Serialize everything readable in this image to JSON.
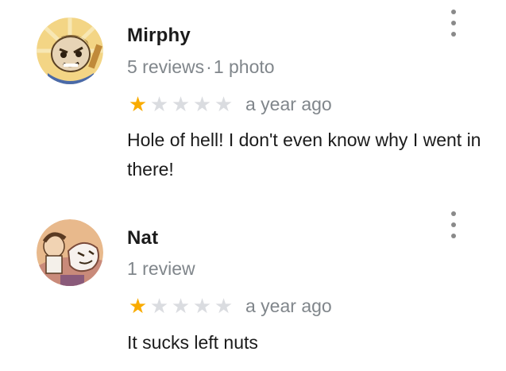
{
  "reviews": [
    {
      "name": "Mirphy",
      "meta_reviews": "5 reviews",
      "meta_separator": "·",
      "meta_photos": "1 photo",
      "rating": 1,
      "rating_max": 5,
      "date": "a year ago",
      "text": "Hole of hell! I don't even know why I went in there!",
      "avatar_icon": "cartoon-face-avatar",
      "more_icon": "more-vertical-icon"
    },
    {
      "name": "Nat",
      "meta_reviews": "1 review",
      "rating": 1,
      "rating_max": 5,
      "date": "a year ago",
      "text": "It sucks left nuts",
      "avatar_icon": "cartoon-characters-avatar",
      "more_icon": "more-vertical-icon"
    }
  ],
  "colors": {
    "star_filled": "#f9ab00",
    "star_empty": "#dadce0",
    "secondary_text": "#80868b"
  }
}
